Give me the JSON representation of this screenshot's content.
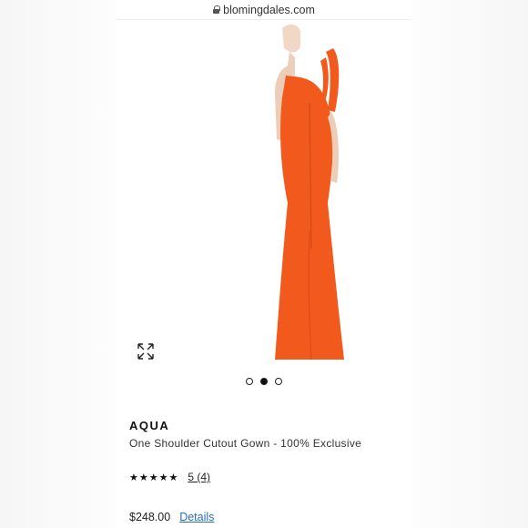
{
  "browser": {
    "url": "blomingdales.com",
    "lock_icon": "lock-icon"
  },
  "product": {
    "brand": "AQUA",
    "name": "One Shoulder Cutout Gown - 100% Exclusive",
    "rating_stars": "★★★★★",
    "rating_text": "5 (4)",
    "rating_value": 5,
    "price": "$248.00",
    "details_label": "Details",
    "dress_color": "#f25a1d"
  },
  "carousel": {
    "count": 3,
    "active_index": 1
  },
  "icons": {
    "expand": "expand-icon"
  },
  "colors": {
    "link": "#2a6ebb",
    "dress": "#f25a1d"
  }
}
